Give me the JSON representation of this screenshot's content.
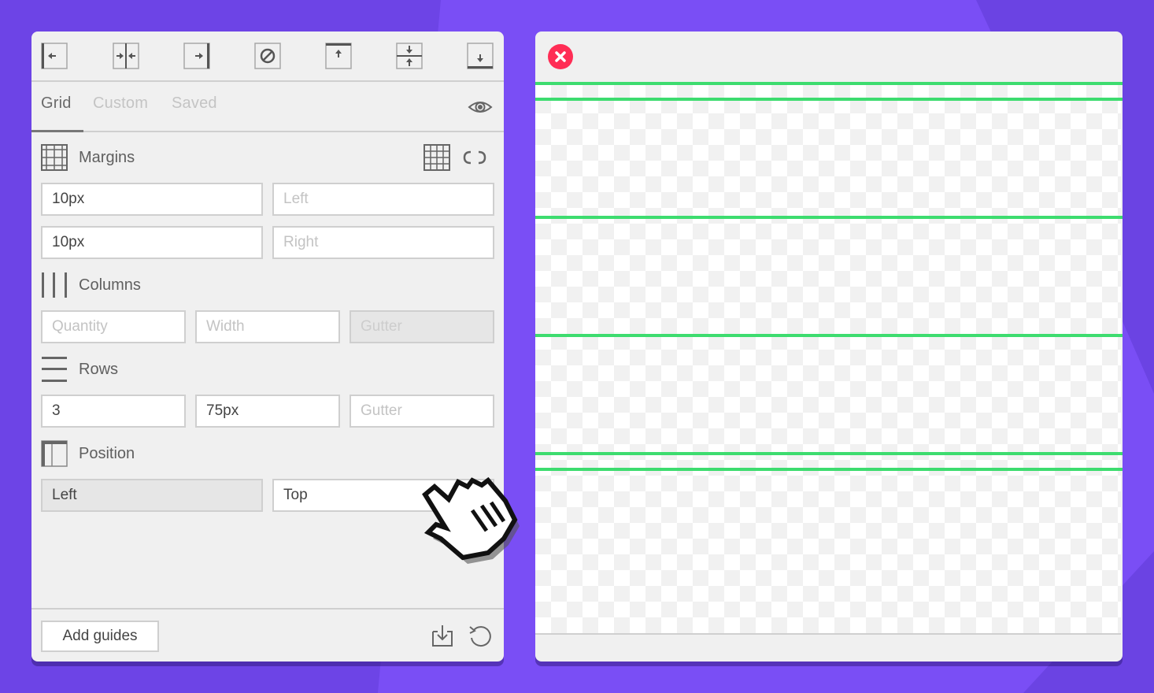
{
  "toolbar": {
    "buttons": [
      {
        "name": "align-left",
        "icon": "align-left-icon"
      },
      {
        "name": "align-center",
        "icon": "align-center-horizontal-icon"
      },
      {
        "name": "align-right",
        "icon": "align-right-icon"
      },
      {
        "name": "no-align",
        "icon": "circle-slash-icon"
      },
      {
        "name": "align-top",
        "icon": "align-top-icon"
      },
      {
        "name": "align-middle",
        "icon": "align-center-vertical-icon"
      },
      {
        "name": "align-bottom",
        "icon": "align-bottom-icon"
      }
    ]
  },
  "tabs": [
    {
      "label": "Grid",
      "active": true
    },
    {
      "label": "Custom",
      "active": false
    },
    {
      "label": "Saved",
      "active": false
    }
  ],
  "margins": {
    "title": "Margins",
    "rows": [
      {
        "value": "10px",
        "placeholder": "Left"
      },
      {
        "value": "10px",
        "placeholder": "Right"
      }
    ]
  },
  "columns": {
    "title": "Columns",
    "quantity_placeholder": "Quantity",
    "width_placeholder": "Width",
    "gutter_placeholder": "Gutter"
  },
  "rows": {
    "title": "Rows",
    "quantity_value": "3",
    "height_value": "75px",
    "gutter_placeholder": "Gutter"
  },
  "position": {
    "title": "Position",
    "horizontal_value": "Left",
    "vertical_value": "Top"
  },
  "footer": {
    "add_label": "Add guides"
  },
  "preview": {
    "guide_color": "#3ddc6f"
  },
  "colors": {
    "background": "#7a4ef5",
    "close": "#ff2d55",
    "guide": "#3ddc6f"
  }
}
